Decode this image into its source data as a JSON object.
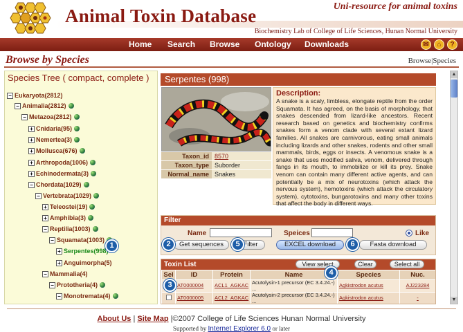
{
  "site": {
    "title": "Animal Toxin Database",
    "slogan": "Uni-resource for animal toxins",
    "lab": "Biochemistry Lab of College of Life Sciences, Hunan Normal University"
  },
  "nav": {
    "items": [
      "Home",
      "Search",
      "Browse",
      "Ontology",
      "Downloads"
    ],
    "icons": [
      "email-icon",
      "home-icon",
      "help-icon"
    ]
  },
  "page": {
    "title": "Browse by Species",
    "breadcrumb": "Browse|Species"
  },
  "tree": {
    "header_prefix": "Species Tree ( ",
    "compact": "compact",
    "sep": ", ",
    "complete": "complete",
    "header_suffix": " )",
    "nodes": [
      {
        "label": "Eukaryota(2812)",
        "toggle": "−"
      },
      {
        "label": "Animalia(2812)",
        "toggle": "−"
      },
      {
        "label": "Metazoa(2812)",
        "toggle": "−"
      },
      {
        "label": "Cnidaria(95)",
        "toggle": "+"
      },
      {
        "label": "Nemertea(3)",
        "toggle": "+"
      },
      {
        "label": "Mollusca(676)",
        "toggle": "+"
      },
      {
        "label": "Arthropoda(1006)",
        "toggle": "+"
      },
      {
        "label": "Echinodermata(3)",
        "toggle": "+"
      },
      {
        "label": "Chordata(1029)",
        "toggle": "−"
      },
      {
        "label": "Vertebrata(1029)",
        "toggle": "−"
      },
      {
        "label": "Teleostei(19)",
        "toggle": "+"
      },
      {
        "label": "Amphibia(3)",
        "toggle": "+"
      },
      {
        "label": "Reptilia(1003)",
        "toggle": "−"
      },
      {
        "label": "Squamata(1003)",
        "toggle": "−"
      },
      {
        "label": "Serpentes(998)",
        "toggle": "+"
      },
      {
        "label": "Anguimorpha(5)",
        "toggle": "+"
      },
      {
        "label": "Mammalia(4)",
        "toggle": "−"
      },
      {
        "label": "Prototheria(4)",
        "toggle": "−"
      },
      {
        "label": "Monotremata(4)",
        "toggle": "−"
      }
    ]
  },
  "species": {
    "header": "Serpentes (998)",
    "info": [
      {
        "key": "Taxon_id",
        "value": "8570"
      },
      {
        "key": "Taxon_type",
        "value": "Suborder"
      },
      {
        "key": "Normal_name",
        "value": "Snakes"
      }
    ],
    "desc_title": "Description:",
    "description": "A snake is a scaly, limbless, elongate reptile from the order Squamata. It has agreed, on the basis of morphology, that snakes descended from lizard-like ancestors. Recent research based on genetics and biochemistry confirms snakes form a venom clade with several extant lizard families. All snakes are carnivorous, eating small animals including lizards and other snakes, rodents and other small mammals, birds, eggs or insects. A venomous snake is a snake that uses modified saliva, venom, delivered through fangs in its mouth, to immobilize or kill its prey. Snake venom can contain many different active agents, and can potentially be a mix of neurotoxins (which attack the nervous system), hemotoxins (which attack the circulatory system), cytotoxins, bungarotoxins and many other toxins that affect the body in different ways."
  },
  "filter": {
    "header": "Filter",
    "name_label": "Name",
    "name_value": "",
    "species_label": "Speices",
    "species_value": "",
    "like_label": "Like",
    "buttons": {
      "get_sequences": "Get sequences",
      "filter": "Filter",
      "excel": "EXCEL download",
      "fasta": "Fasta download"
    }
  },
  "toxin_list": {
    "header": "Toxin List",
    "buttons": {
      "view_select": "View select",
      "clear": "Clear",
      "select_all": "Select all"
    },
    "columns": [
      "Sel",
      "ID",
      "Protein",
      "Name",
      "Species",
      "Nuc."
    ],
    "rows": [
      {
        "id": "AT0000004",
        "protein": "ACL1_AGKAC",
        "name": "Acutolysin-1 precursor (EC 3.4.24.-) ...",
        "species": "Agkistrodon acutus",
        "nuc": "AJ223284"
      },
      {
        "id": "AT0000005",
        "protein": "ACL2_AGKAC",
        "name": "Acutolysin-2 precursor (EC 3.4.24.-) ...",
        "species": "Agkistrodon acutus",
        "nuc": "-"
      }
    ]
  },
  "callouts": [
    "1",
    "2",
    "3",
    "4",
    "5",
    "6"
  ],
  "footer": {
    "about": "About Us",
    "sep": " | ",
    "sitemap": "Site Map",
    "copyright": " |©2007 College of Life Sciences Hunan Normal University",
    "supported_prefix": "Supported by ",
    "browser": "Internet Explorer 6.0",
    "supported_suffix": " or later"
  },
  "colors": {
    "brand": "#8a1a12",
    "nav": "#8e2a1c",
    "panel_header": "#b44a2a",
    "callout": "#1e5ea8"
  }
}
